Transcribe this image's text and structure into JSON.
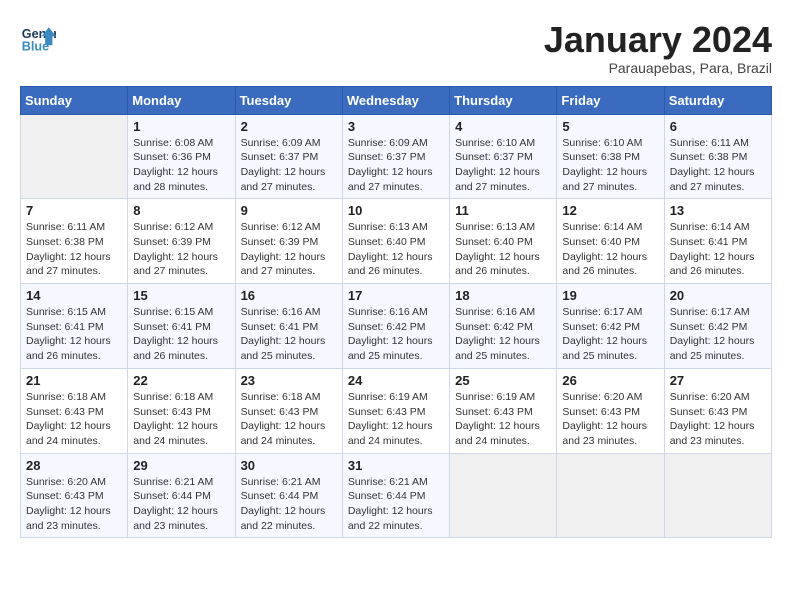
{
  "logo": {
    "line1": "General",
    "line2": "Blue"
  },
  "title": "January 2024",
  "location": "Parauapebas, Para, Brazil",
  "weekdays": [
    "Sunday",
    "Monday",
    "Tuesday",
    "Wednesday",
    "Thursday",
    "Friday",
    "Saturday"
  ],
  "weeks": [
    [
      {
        "day": "",
        "info": ""
      },
      {
        "day": "1",
        "info": "Sunrise: 6:08 AM\nSunset: 6:36 PM\nDaylight: 12 hours\nand 28 minutes."
      },
      {
        "day": "2",
        "info": "Sunrise: 6:09 AM\nSunset: 6:37 PM\nDaylight: 12 hours\nand 27 minutes."
      },
      {
        "day": "3",
        "info": "Sunrise: 6:09 AM\nSunset: 6:37 PM\nDaylight: 12 hours\nand 27 minutes."
      },
      {
        "day": "4",
        "info": "Sunrise: 6:10 AM\nSunset: 6:37 PM\nDaylight: 12 hours\nand 27 minutes."
      },
      {
        "day": "5",
        "info": "Sunrise: 6:10 AM\nSunset: 6:38 PM\nDaylight: 12 hours\nand 27 minutes."
      },
      {
        "day": "6",
        "info": "Sunrise: 6:11 AM\nSunset: 6:38 PM\nDaylight: 12 hours\nand 27 minutes."
      }
    ],
    [
      {
        "day": "7",
        "info": "Sunrise: 6:11 AM\nSunset: 6:38 PM\nDaylight: 12 hours\nand 27 minutes."
      },
      {
        "day": "8",
        "info": "Sunrise: 6:12 AM\nSunset: 6:39 PM\nDaylight: 12 hours\nand 27 minutes."
      },
      {
        "day": "9",
        "info": "Sunrise: 6:12 AM\nSunset: 6:39 PM\nDaylight: 12 hours\nand 27 minutes."
      },
      {
        "day": "10",
        "info": "Sunrise: 6:13 AM\nSunset: 6:40 PM\nDaylight: 12 hours\nand 26 minutes."
      },
      {
        "day": "11",
        "info": "Sunrise: 6:13 AM\nSunset: 6:40 PM\nDaylight: 12 hours\nand 26 minutes."
      },
      {
        "day": "12",
        "info": "Sunrise: 6:14 AM\nSunset: 6:40 PM\nDaylight: 12 hours\nand 26 minutes."
      },
      {
        "day": "13",
        "info": "Sunrise: 6:14 AM\nSunset: 6:41 PM\nDaylight: 12 hours\nand 26 minutes."
      }
    ],
    [
      {
        "day": "14",
        "info": "Sunrise: 6:15 AM\nSunset: 6:41 PM\nDaylight: 12 hours\nand 26 minutes."
      },
      {
        "day": "15",
        "info": "Sunrise: 6:15 AM\nSunset: 6:41 PM\nDaylight: 12 hours\nand 26 minutes."
      },
      {
        "day": "16",
        "info": "Sunrise: 6:16 AM\nSunset: 6:41 PM\nDaylight: 12 hours\nand 25 minutes."
      },
      {
        "day": "17",
        "info": "Sunrise: 6:16 AM\nSunset: 6:42 PM\nDaylight: 12 hours\nand 25 minutes."
      },
      {
        "day": "18",
        "info": "Sunrise: 6:16 AM\nSunset: 6:42 PM\nDaylight: 12 hours\nand 25 minutes."
      },
      {
        "day": "19",
        "info": "Sunrise: 6:17 AM\nSunset: 6:42 PM\nDaylight: 12 hours\nand 25 minutes."
      },
      {
        "day": "20",
        "info": "Sunrise: 6:17 AM\nSunset: 6:42 PM\nDaylight: 12 hours\nand 25 minutes."
      }
    ],
    [
      {
        "day": "21",
        "info": "Sunrise: 6:18 AM\nSunset: 6:43 PM\nDaylight: 12 hours\nand 24 minutes."
      },
      {
        "day": "22",
        "info": "Sunrise: 6:18 AM\nSunset: 6:43 PM\nDaylight: 12 hours\nand 24 minutes."
      },
      {
        "day": "23",
        "info": "Sunrise: 6:18 AM\nSunset: 6:43 PM\nDaylight: 12 hours\nand 24 minutes."
      },
      {
        "day": "24",
        "info": "Sunrise: 6:19 AM\nSunset: 6:43 PM\nDaylight: 12 hours\nand 24 minutes."
      },
      {
        "day": "25",
        "info": "Sunrise: 6:19 AM\nSunset: 6:43 PM\nDaylight: 12 hours\nand 24 minutes."
      },
      {
        "day": "26",
        "info": "Sunrise: 6:20 AM\nSunset: 6:43 PM\nDaylight: 12 hours\nand 23 minutes."
      },
      {
        "day": "27",
        "info": "Sunrise: 6:20 AM\nSunset: 6:43 PM\nDaylight: 12 hours\nand 23 minutes."
      }
    ],
    [
      {
        "day": "28",
        "info": "Sunrise: 6:20 AM\nSunset: 6:43 PM\nDaylight: 12 hours\nand 23 minutes."
      },
      {
        "day": "29",
        "info": "Sunrise: 6:21 AM\nSunset: 6:44 PM\nDaylight: 12 hours\nand 23 minutes."
      },
      {
        "day": "30",
        "info": "Sunrise: 6:21 AM\nSunset: 6:44 PM\nDaylight: 12 hours\nand 22 minutes."
      },
      {
        "day": "31",
        "info": "Sunrise: 6:21 AM\nSunset: 6:44 PM\nDaylight: 12 hours\nand 22 minutes."
      },
      {
        "day": "",
        "info": ""
      },
      {
        "day": "",
        "info": ""
      },
      {
        "day": "",
        "info": ""
      }
    ]
  ]
}
